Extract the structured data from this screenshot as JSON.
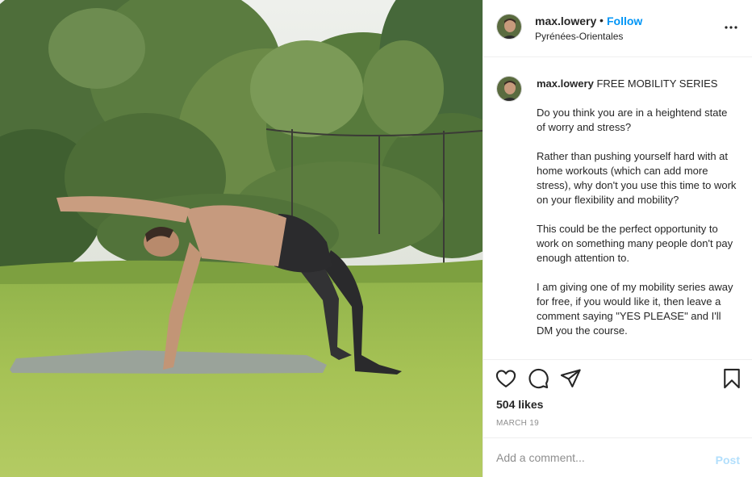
{
  "post": {
    "author": {
      "username": "max.lowery",
      "follow_label": "Follow",
      "separator": "•",
      "location": "Pyrénées-Orientales"
    },
    "caption": {
      "username": "max.lowery",
      "text": "FREE MOBILITY SERIES\n\nDo you think you are in a heightend state of worry and stress?\n\nRather than pushing yourself hard with at home workouts (which can add more stress), why don't you use this time to work on your flexibility and mobility?\n\nThis could be the perfect opportunity to work on something many people don't pay enough attention to.\n\nI am giving one of my mobility series away for free, if you would like it, then leave a comment saying \"YES PLEASE\" and I'll DM you the course."
    },
    "likes": "504 likes",
    "date": "MARCH 19",
    "comment_box": {
      "placeholder": "Add a comment...",
      "post_label": "Post"
    }
  },
  "icons": {
    "more": "more-horizontal-icon",
    "like": "heart-icon",
    "comment": "comment-bubble-icon",
    "share": "paper-plane-icon",
    "save": "bookmark-icon"
  },
  "colors": {
    "link_blue": "#0095f6",
    "post_disabled": "#b2dffc",
    "secondary_text": "#8e8e8e",
    "divider": "#efefef"
  }
}
